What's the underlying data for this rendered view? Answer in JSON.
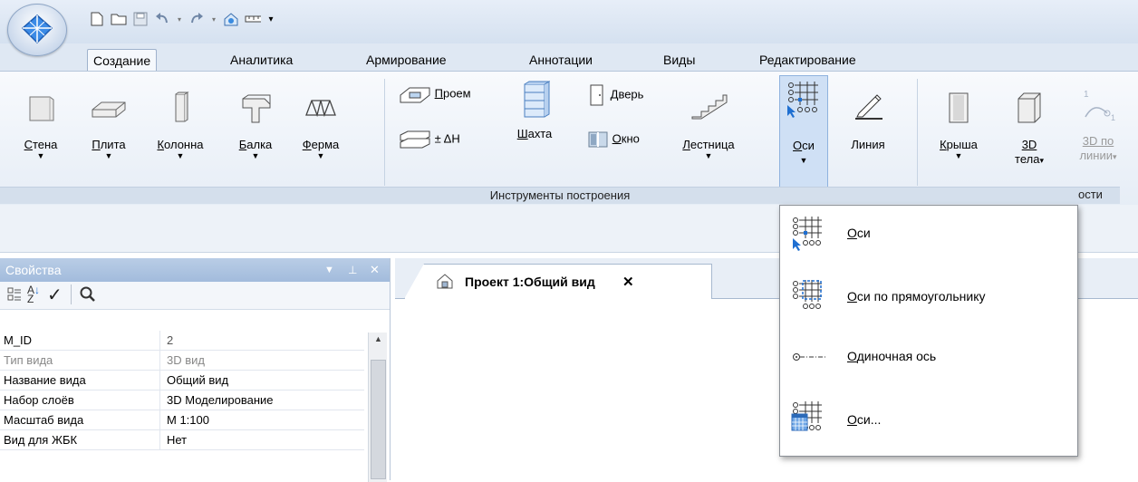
{
  "tabs": [
    "Создание",
    "Аналитика",
    "Армирование",
    "Аннотации",
    "Виды",
    "Редактирование"
  ],
  "ribbon": {
    "stena": "Стена",
    "plita": "Плита",
    "kolonna": "Колонна",
    "balka": "Балка",
    "ferma": "Ферма",
    "proem": "Проем",
    "dh": "± ΔH",
    "shakhta": "Шахта",
    "dver": "Дверь",
    "okno": "Окно",
    "lestnica": "Лестница",
    "osi": "Оси",
    "liniya": "Линия",
    "krysha": "Крыша",
    "tela_3d_top": "3D",
    "tela_3d_bottom": "тела",
    "po_linii_top": "3D по",
    "po_linii_bottom": "линии",
    "group_label": "Инструменты построения",
    "group_label_2": "ости"
  },
  "dropdown": {
    "items": [
      "Оси",
      "Оси по прямоугольнику",
      "Одиночная ось",
      "Оси..."
    ]
  },
  "properties": {
    "title": "Свойства",
    "rows": [
      {
        "key": "M_ID",
        "value": "2"
      },
      {
        "key": "Тип вида",
        "value": "3D вид"
      },
      {
        "key": "Название вида",
        "value": "Общий вид"
      },
      {
        "key": "Набор слоёв",
        "value": "3D Моделирование"
      },
      {
        "key": "Масштаб вида",
        "value": "М 1:100"
      },
      {
        "key": "Вид для ЖБК",
        "value": "Нет"
      }
    ]
  },
  "document_tab": {
    "title": "Проект 1:Общий вид",
    "close": "✕"
  },
  "colors": {
    "ribbon_bg": "#e6edf6",
    "highlight": "#cfe0f5",
    "panel_header": "#a2bbdc",
    "accent_blue": "#1f6fd1"
  }
}
